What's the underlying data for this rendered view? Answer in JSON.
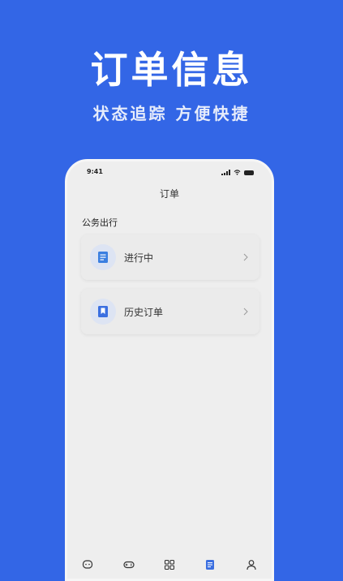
{
  "promo": {
    "title": "订单信息",
    "subtitle": "状态追踪 方便快捷"
  },
  "status_bar": {
    "time": "9:41"
  },
  "nav": {
    "title": "订单"
  },
  "section": {
    "title": "公务出行"
  },
  "cards": [
    {
      "label": "进行中",
      "icon": "document-icon"
    },
    {
      "label": "历史订单",
      "icon": "bookmark-icon"
    }
  ],
  "tabs": [
    {
      "icon": "chat-icon",
      "label": "",
      "active": false
    },
    {
      "icon": "gamepad-icon",
      "label": "",
      "active": false
    },
    {
      "icon": "grid-icon",
      "label": "",
      "active": false
    },
    {
      "icon": "orders-icon",
      "label": "",
      "active": true
    },
    {
      "icon": "user-icon",
      "label": "",
      "active": false
    }
  ],
  "colors": {
    "background": "#3366e6",
    "accent": "#3b6fe0",
    "phone_bg": "#eeeeee"
  }
}
